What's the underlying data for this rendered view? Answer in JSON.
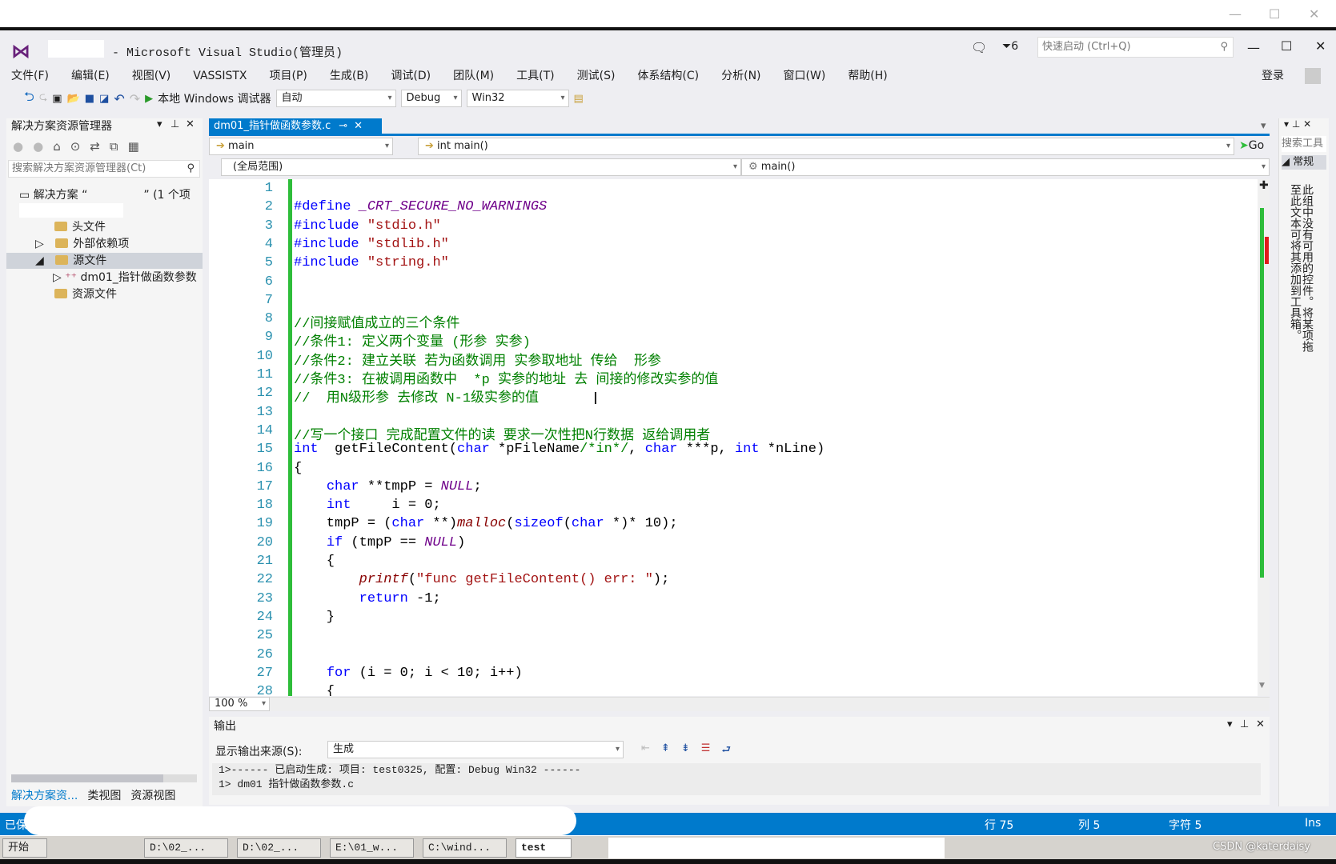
{
  "window": {
    "title": "- Microsoft Visual Studio(管理员)",
    "notifications": "6",
    "quick_launch_placeholder": "快速启动 (Ctrl+Q)",
    "login": "登录",
    "min": "—",
    "max": "☐",
    "close": "✕"
  },
  "menu": [
    "文件(F)",
    "编辑(E)",
    "视图(V)",
    "VASSISTX",
    "项目(P)",
    "生成(B)",
    "调试(D)",
    "团队(M)",
    "工具(T)",
    "测试(S)",
    "体系结构(C)",
    "分析(N)",
    "窗口(W)",
    "帮助(H)"
  ],
  "toolbar": {
    "run_label": "本地 Windows 调试器",
    "config_auto": "自动",
    "config": "Debug",
    "platform": "Win32"
  },
  "solution_explorer": {
    "title": "解决方案资源管理器",
    "search_placeholder": "搜索解决方案资源管理器(Ct)",
    "solution_label": "解决方案 “",
    "solution_suffix": "” (1 个项",
    "items": [
      "头文件",
      "外部依赖项",
      "源文件",
      "dm01_指针做函数参数",
      "资源文件"
    ],
    "bottom_tabs": [
      "解决方案资...",
      "类视图",
      "资源视图"
    ]
  },
  "editor": {
    "tab_label": "dm01_指针做函数参数.c",
    "nav_scope": "main",
    "nav_member": "int main()",
    "go": "Go",
    "scope2": "(全局范围)",
    "member2": "main()",
    "zoom": "100 %",
    "lines": [
      {
        "n": "1",
        "t": ""
      },
      {
        "n": "2",
        "t": "#define _CRT_SECURE_NO_WARNINGS"
      },
      {
        "n": "3",
        "t": "#include \"stdio.h\""
      },
      {
        "n": "4",
        "t": "#include \"stdlib.h\""
      },
      {
        "n": "5",
        "t": "#include \"string.h\""
      },
      {
        "n": "6",
        "t": ""
      },
      {
        "n": "7",
        "t": ""
      },
      {
        "n": "8",
        "t": "//间接赋值成立的三个条件"
      },
      {
        "n": "9",
        "t": "//条件1: 定义两个变量 (形参 实参)"
      },
      {
        "n": "10",
        "t": "//条件2: 建立关联 若为函数调用 实参取地址 传给  形参"
      },
      {
        "n": "11",
        "t": "//条件3: 在被调用函数中  *p 实参的地址 去 间接的修改实参的值"
      },
      {
        "n": "12",
        "t": "//  用N级形参 去修改 N-1级实参的值"
      },
      {
        "n": "13",
        "t": ""
      },
      {
        "n": "14",
        "t": "//写一个接口 完成配置文件的读 要求一次性把N行数据 返给调用者"
      },
      {
        "n": "15",
        "t": "int  getFileContent(char *pFileName/*in*/, char ***p, int *nLine)"
      },
      {
        "n": "16",
        "t": "{"
      },
      {
        "n": "17",
        "t": "    char **tmpP = NULL;"
      },
      {
        "n": "18",
        "t": "    int     i = 0;"
      },
      {
        "n": "19",
        "t": "    tmpP = (char **)malloc(sizeof(char *)* 10);"
      },
      {
        "n": "20",
        "t": "    if (tmpP == NULL)"
      },
      {
        "n": "21",
        "t": "    {"
      },
      {
        "n": "22",
        "t": "        printf(\"func getFileContent() err: \");"
      },
      {
        "n": "23",
        "t": "        return -1;"
      },
      {
        "n": "24",
        "t": "    }"
      },
      {
        "n": "25",
        "t": ""
      },
      {
        "n": "26",
        "t": ""
      },
      {
        "n": "27",
        "t": "    for (i = 0; i < 10; i++)"
      },
      {
        "n": "28",
        "t": "    {"
      }
    ]
  },
  "output": {
    "title": "输出",
    "source_label": "显示输出来源(S):",
    "source_value": "生成",
    "lines": [
      "1>------ 已启动生成:  项目: test0325, 配置: Debug Win32 ------",
      "1>  dm01 指针做函数参数.c"
    ]
  },
  "toolbox": {
    "search": "搜索工具",
    "group": "常规",
    "empty_text": "此组中没有可用的控件。将某项拖至此文本可将其添加到工具箱。"
  },
  "status": {
    "left": "已保存的项",
    "row": "行 75",
    "col": "列 5",
    "char": "字符 5",
    "mode": "Ins"
  },
  "taskbar": {
    "start": "开始",
    "tasks": [
      "D:\\02_...",
      "D:\\02_...",
      "E:\\01_w...",
      "C:\\wind...",
      "test"
    ],
    "watermark": "CSDN @katerdaisy"
  },
  "colors": {
    "accent": "#007acc",
    "vs_purple": "#68217a",
    "change_bar": "#2ebd3a"
  }
}
